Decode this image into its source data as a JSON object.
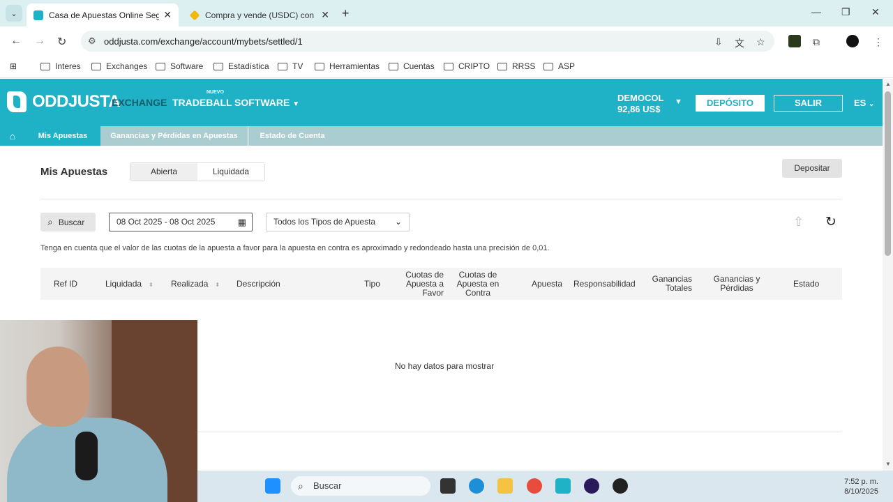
{
  "browser": {
    "tabs": [
      {
        "title": "Casa de Apuestas Online Segur",
        "active": true
      },
      {
        "title": "Compra y vende (USDC) con Ne",
        "active": false
      }
    ],
    "url": "oddjusta.com/exchange/account/mybets/settled/1",
    "bookmarks": [
      "Interes",
      "Exchanges",
      "Software",
      "Estadística",
      "TV",
      "Herramientas",
      "Cuentas",
      "CRIPTO",
      "RRSS",
      "ASP"
    ]
  },
  "site": {
    "logo": "ODDJUSTA",
    "nav": {
      "exchange": "EXCHANGE",
      "tradeball": "TRADEBALL",
      "nuevo": "NUEVO",
      "software": "SOFTWARE"
    },
    "account": {
      "name": "DEMOCOL",
      "balance": "92,86 US$"
    },
    "deposito": "DEPÓSITO",
    "salir": "SALIR",
    "lang": "ES",
    "subnav": [
      "Mis Apuestas",
      "Ganancias y Pérdidas en Apuestas",
      "Estado de Cuenta"
    ]
  },
  "main": {
    "title": "Mis Apuestas",
    "toggle": [
      "Abierta",
      "Liquidada"
    ],
    "depositar": "Depositar",
    "buscar": "Buscar",
    "date_range": "08 Oct 2025 - 08 Oct 2025",
    "bet_type": "Todos los Tipos de Apuesta",
    "note": "Tenga en cuenta que el valor de las cuotas de la apuesta a favor para la apuesta en contra es aproximado y redondeado hasta una precisión de 0,01.",
    "columns": [
      "Ref ID",
      "Liquidada",
      "Realizada",
      "Descripción",
      "Tipo",
      "Cuotas de Apuesta a Favor",
      "Cuotas de Apuesta en Contra",
      "Apuesta",
      "Responsabilidad",
      "Ganancias Totales",
      "Ganancias y Pérdidas",
      "Estado"
    ],
    "empty": "No hay datos para mostrar"
  },
  "taskbar": {
    "search": "Buscar",
    "time": "7:52 p. m.",
    "date": "8/10/2025"
  },
  "colors": {
    "brand": "#1fb2c6",
    "subnav": "#a9cdd1"
  }
}
